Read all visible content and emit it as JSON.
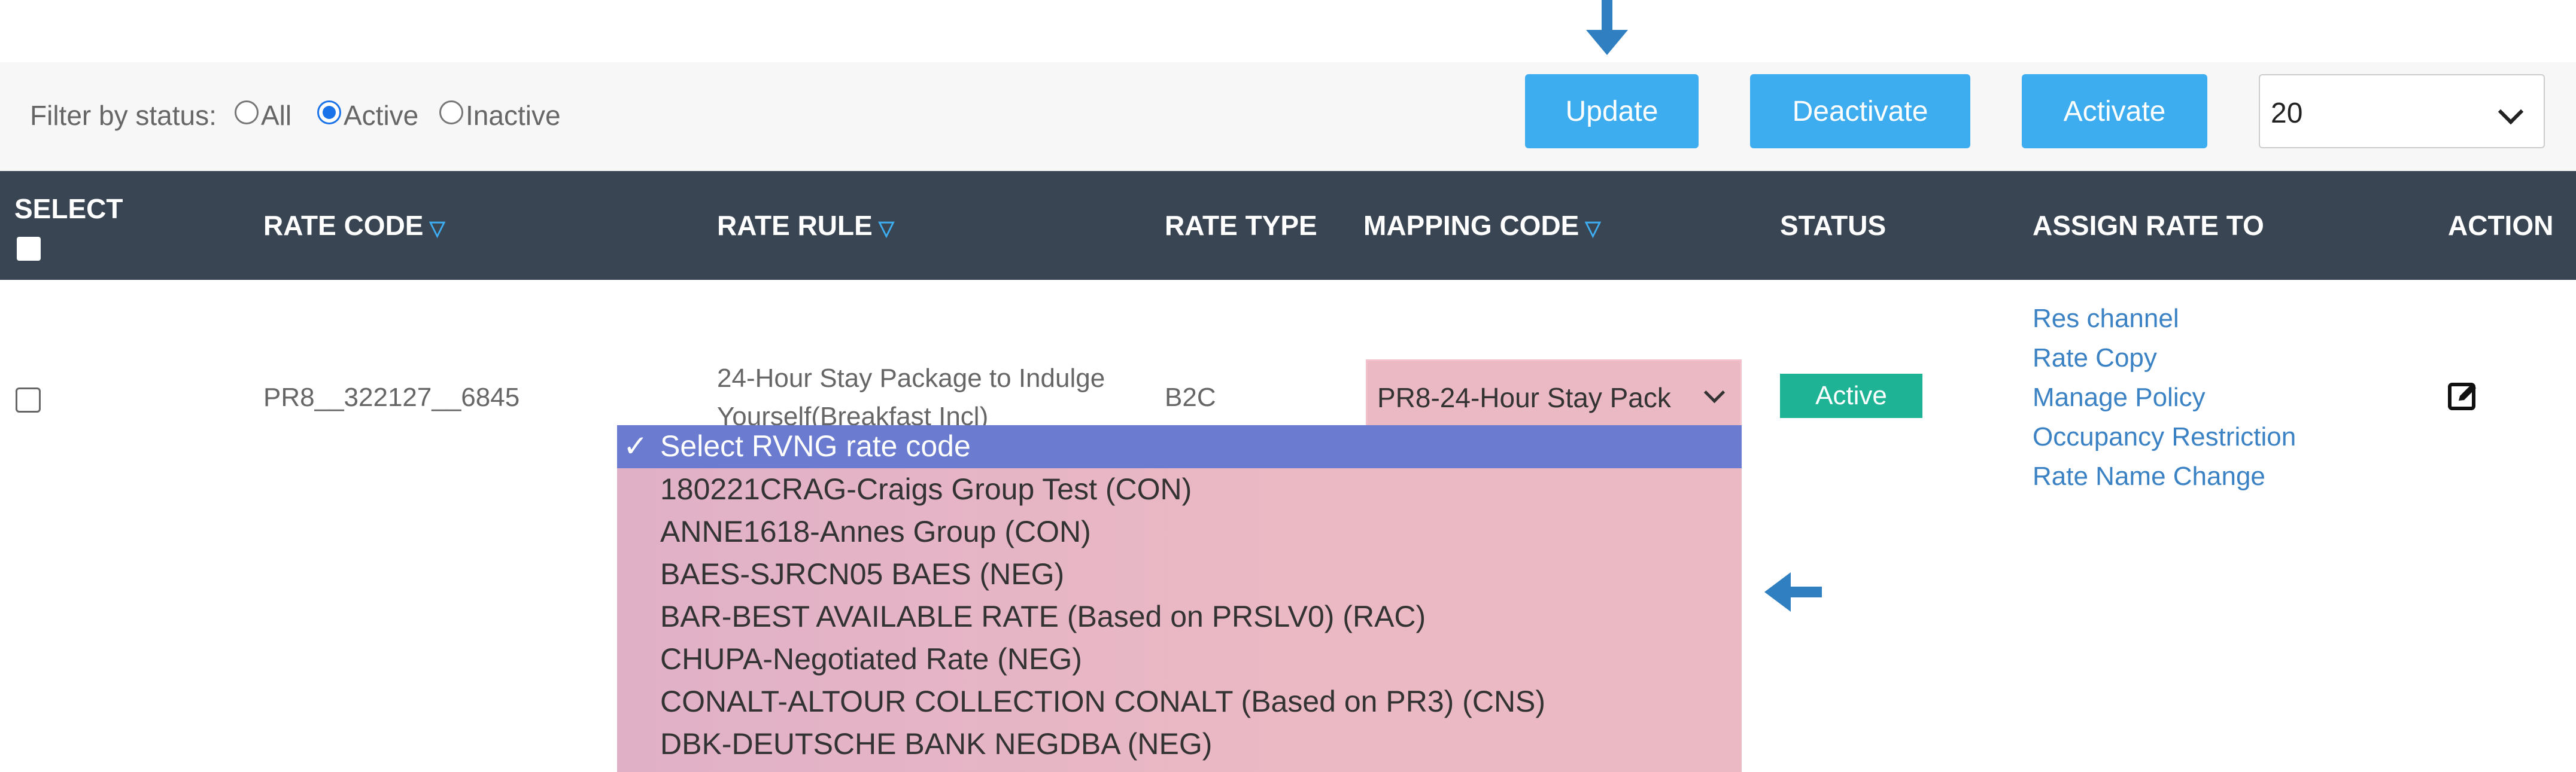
{
  "filter": {
    "label": "Filter by status:",
    "options": [
      {
        "label": "All",
        "checked": false
      },
      {
        "label": "Active",
        "checked": true
      },
      {
        "label": "Inactive",
        "checked": false
      }
    ]
  },
  "toolbar": {
    "update_label": "Update",
    "deactivate_label": "Deactivate",
    "activate_label": "Activate",
    "page_size": "20"
  },
  "table": {
    "headers": {
      "select": "SELECT",
      "rate_code": "RATE CODE",
      "rate_rule": "RATE RULE",
      "rate_type": "RATE TYPE",
      "mapping_code": "MAPPING CODE",
      "status": "STATUS",
      "assign_rate_to": "ASSIGN RATE TO",
      "action": "ACTION"
    },
    "sort_icon": "▽",
    "row": {
      "rate_code": "PR8__322127__6845",
      "rate_rule_line1": "24-Hour Stay Package to Indulge",
      "rate_rule_line2": "Yourself(Breakfast Incl)",
      "rate_type": "B2C",
      "mapping_value": "PR8-24-Hour Stay Pack",
      "status": "Active",
      "assign_links": [
        "Res channel",
        "Rate Copy",
        "Manage Policy",
        "Occupancy Restriction",
        "Rate Name Change"
      ],
      "action_icon": "edit-icon"
    }
  },
  "dropdown": {
    "check_mark": "✓",
    "selected": "Select RVNG rate code",
    "options": [
      "180221CRAG-Craigs Group Test (CON)",
      "ANNE1618-Annes Group (CON)",
      "BAES-SJRCN05 BAES (NEG)",
      "BAR-BEST AVAILABLE RATE (Based on PRSLV0) (RAC)",
      "CHUPA-Negotiated Rate (NEG)",
      "CONALT-ALTOUR COLLECTION CONALT (Based on PR3) (CNS)",
      "DBK-DEUTSCHE BANK NEGDBA (NEG)"
    ]
  },
  "colors": {
    "accent": "#3dadf0",
    "header_bg": "#3a4553",
    "active_badge": "#1eb394",
    "dropdown_bg": "#ebb9c4",
    "dropdown_selected": "#6b7bcf",
    "link": "#3a82c4"
  }
}
